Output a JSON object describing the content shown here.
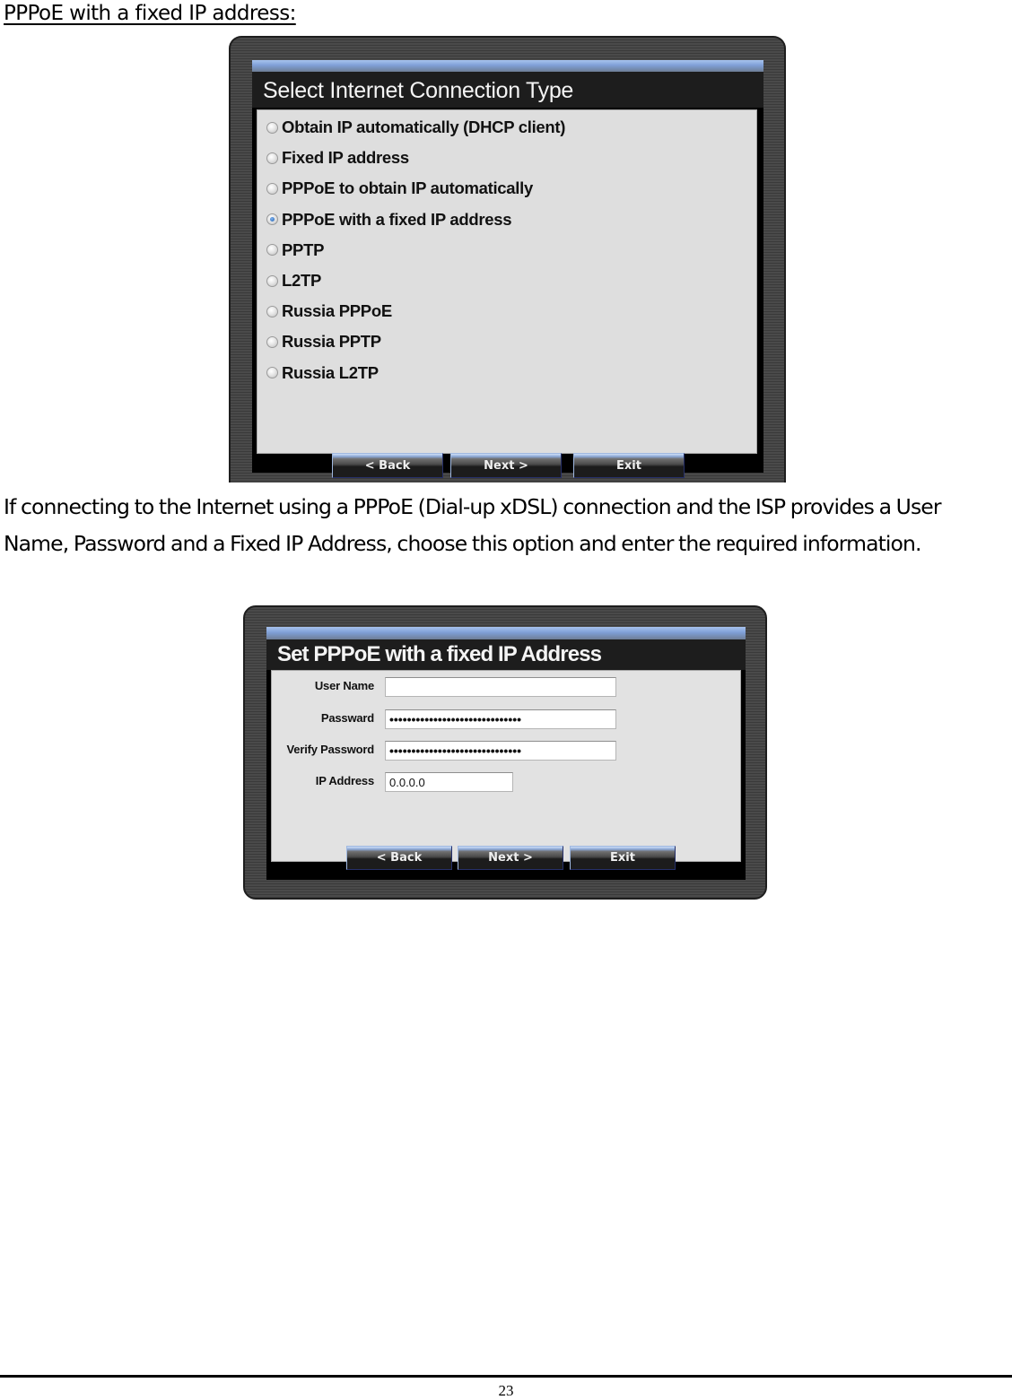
{
  "heading": "PPPoE with a fixed IP address:",
  "description": "If connecting to the Internet using a PPPoE (Dial-up xDSL) connection and the ISP provides a User Name, Password and a Fixed IP Address, choose this option and enter the required information.",
  "dialog_connection_type": {
    "title": "Select Internet Connection Type",
    "options": [
      {
        "label": "Obtain IP automatically (DHCP client)",
        "selected": false
      },
      {
        "label": "Fixed IP address",
        "selected": false
      },
      {
        "label": "PPPoE to obtain IP automatically",
        "selected": false
      },
      {
        "label": "PPPoE with a fixed IP address",
        "selected": true
      },
      {
        "label": "PPTP",
        "selected": false
      },
      {
        "label": "L2TP",
        "selected": false
      },
      {
        "label": "Russia PPPoE",
        "selected": false
      },
      {
        "label": "Russia PPTP",
        "selected": false
      },
      {
        "label": "Russia L2TP",
        "selected": false
      }
    ],
    "buttons": {
      "back": "< Back",
      "next": "Next >",
      "exit": "Exit"
    }
  },
  "dialog_pppoe_fixed": {
    "title": "Set PPPoE with a fixed IP Address",
    "fields": {
      "user_name": {
        "label": "User Name",
        "value": ""
      },
      "password": {
        "label": "Passward",
        "value": "••••••••••••••••••••••••••••••"
      },
      "verify_password": {
        "label": "Verify Password",
        "value": "••••••••••••••••••••••••••••••"
      },
      "ip_address": {
        "label": "IP Address",
        "value": "0.0.0.0"
      }
    },
    "buttons": {
      "back": "< Back",
      "next": "Next >",
      "exit": "Exit"
    }
  },
  "footer": {
    "page_number": "23"
  }
}
